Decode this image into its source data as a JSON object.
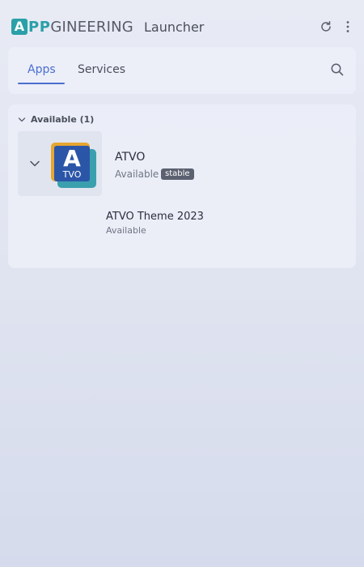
{
  "header": {
    "logo_a": "A",
    "logo_pp": "PP",
    "logo_rest": "GINEERING",
    "title": "Launcher",
    "refresh_icon": "refresh-icon",
    "menu_icon": "more-vertical-icon"
  },
  "tabs": [
    {
      "label": "Apps",
      "active": true
    },
    {
      "label": "Services",
      "active": false
    }
  ],
  "search_icon": "search-icon",
  "groups": [
    {
      "title": "Available (1)",
      "expanded": true,
      "apps": [
        {
          "name": "ATVO",
          "status": "Available",
          "badge": "stable",
          "icon_letter": "A",
          "icon_sub": "TVO",
          "children": [
            {
              "name": "ATVO Theme 2023",
              "status": "Available"
            }
          ]
        }
      ]
    }
  ],
  "colors": {
    "accent": "#4a6fd0",
    "brand_teal": "#2aa0a8",
    "badge_bg": "#5b6170",
    "icon_orange": "#e6a630",
    "icon_blue": "#2b56a8",
    "icon_teal": "#3aa0ae"
  }
}
